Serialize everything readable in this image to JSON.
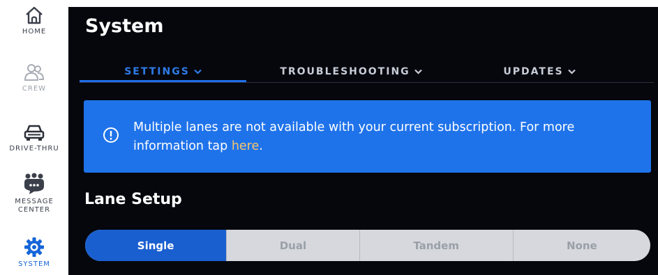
{
  "sidebar": {
    "items": [
      {
        "label": "HOME",
        "icon": "home-icon"
      },
      {
        "label": "CREW",
        "icon": "crew-icon"
      },
      {
        "label": "DRIVE-THRU",
        "icon": "car-icon"
      },
      {
        "label": "MESSAGE CENTER",
        "icon": "message-center-icon"
      },
      {
        "label": "SYSTEM",
        "icon": "gear-icon"
      }
    ]
  },
  "header": {
    "title": "System"
  },
  "tabs": [
    {
      "label": "SETTINGS",
      "active": true
    },
    {
      "label": "TROUBLESHOOTING",
      "active": false
    },
    {
      "label": "UPDATES",
      "active": false
    }
  ],
  "banner": {
    "icon": "info-icon",
    "text": "Multiple lanes are not available with your current subscription. For more information tap ",
    "link": "here",
    "suffix": "."
  },
  "lane_setup": {
    "title": "Lane Setup",
    "options": [
      "Single",
      "Dual",
      "Tandem",
      "None"
    ],
    "selected": "Single"
  },
  "colors": {
    "accent": "#1f73ea",
    "background": "#05070d",
    "link": "#f5c56b"
  }
}
